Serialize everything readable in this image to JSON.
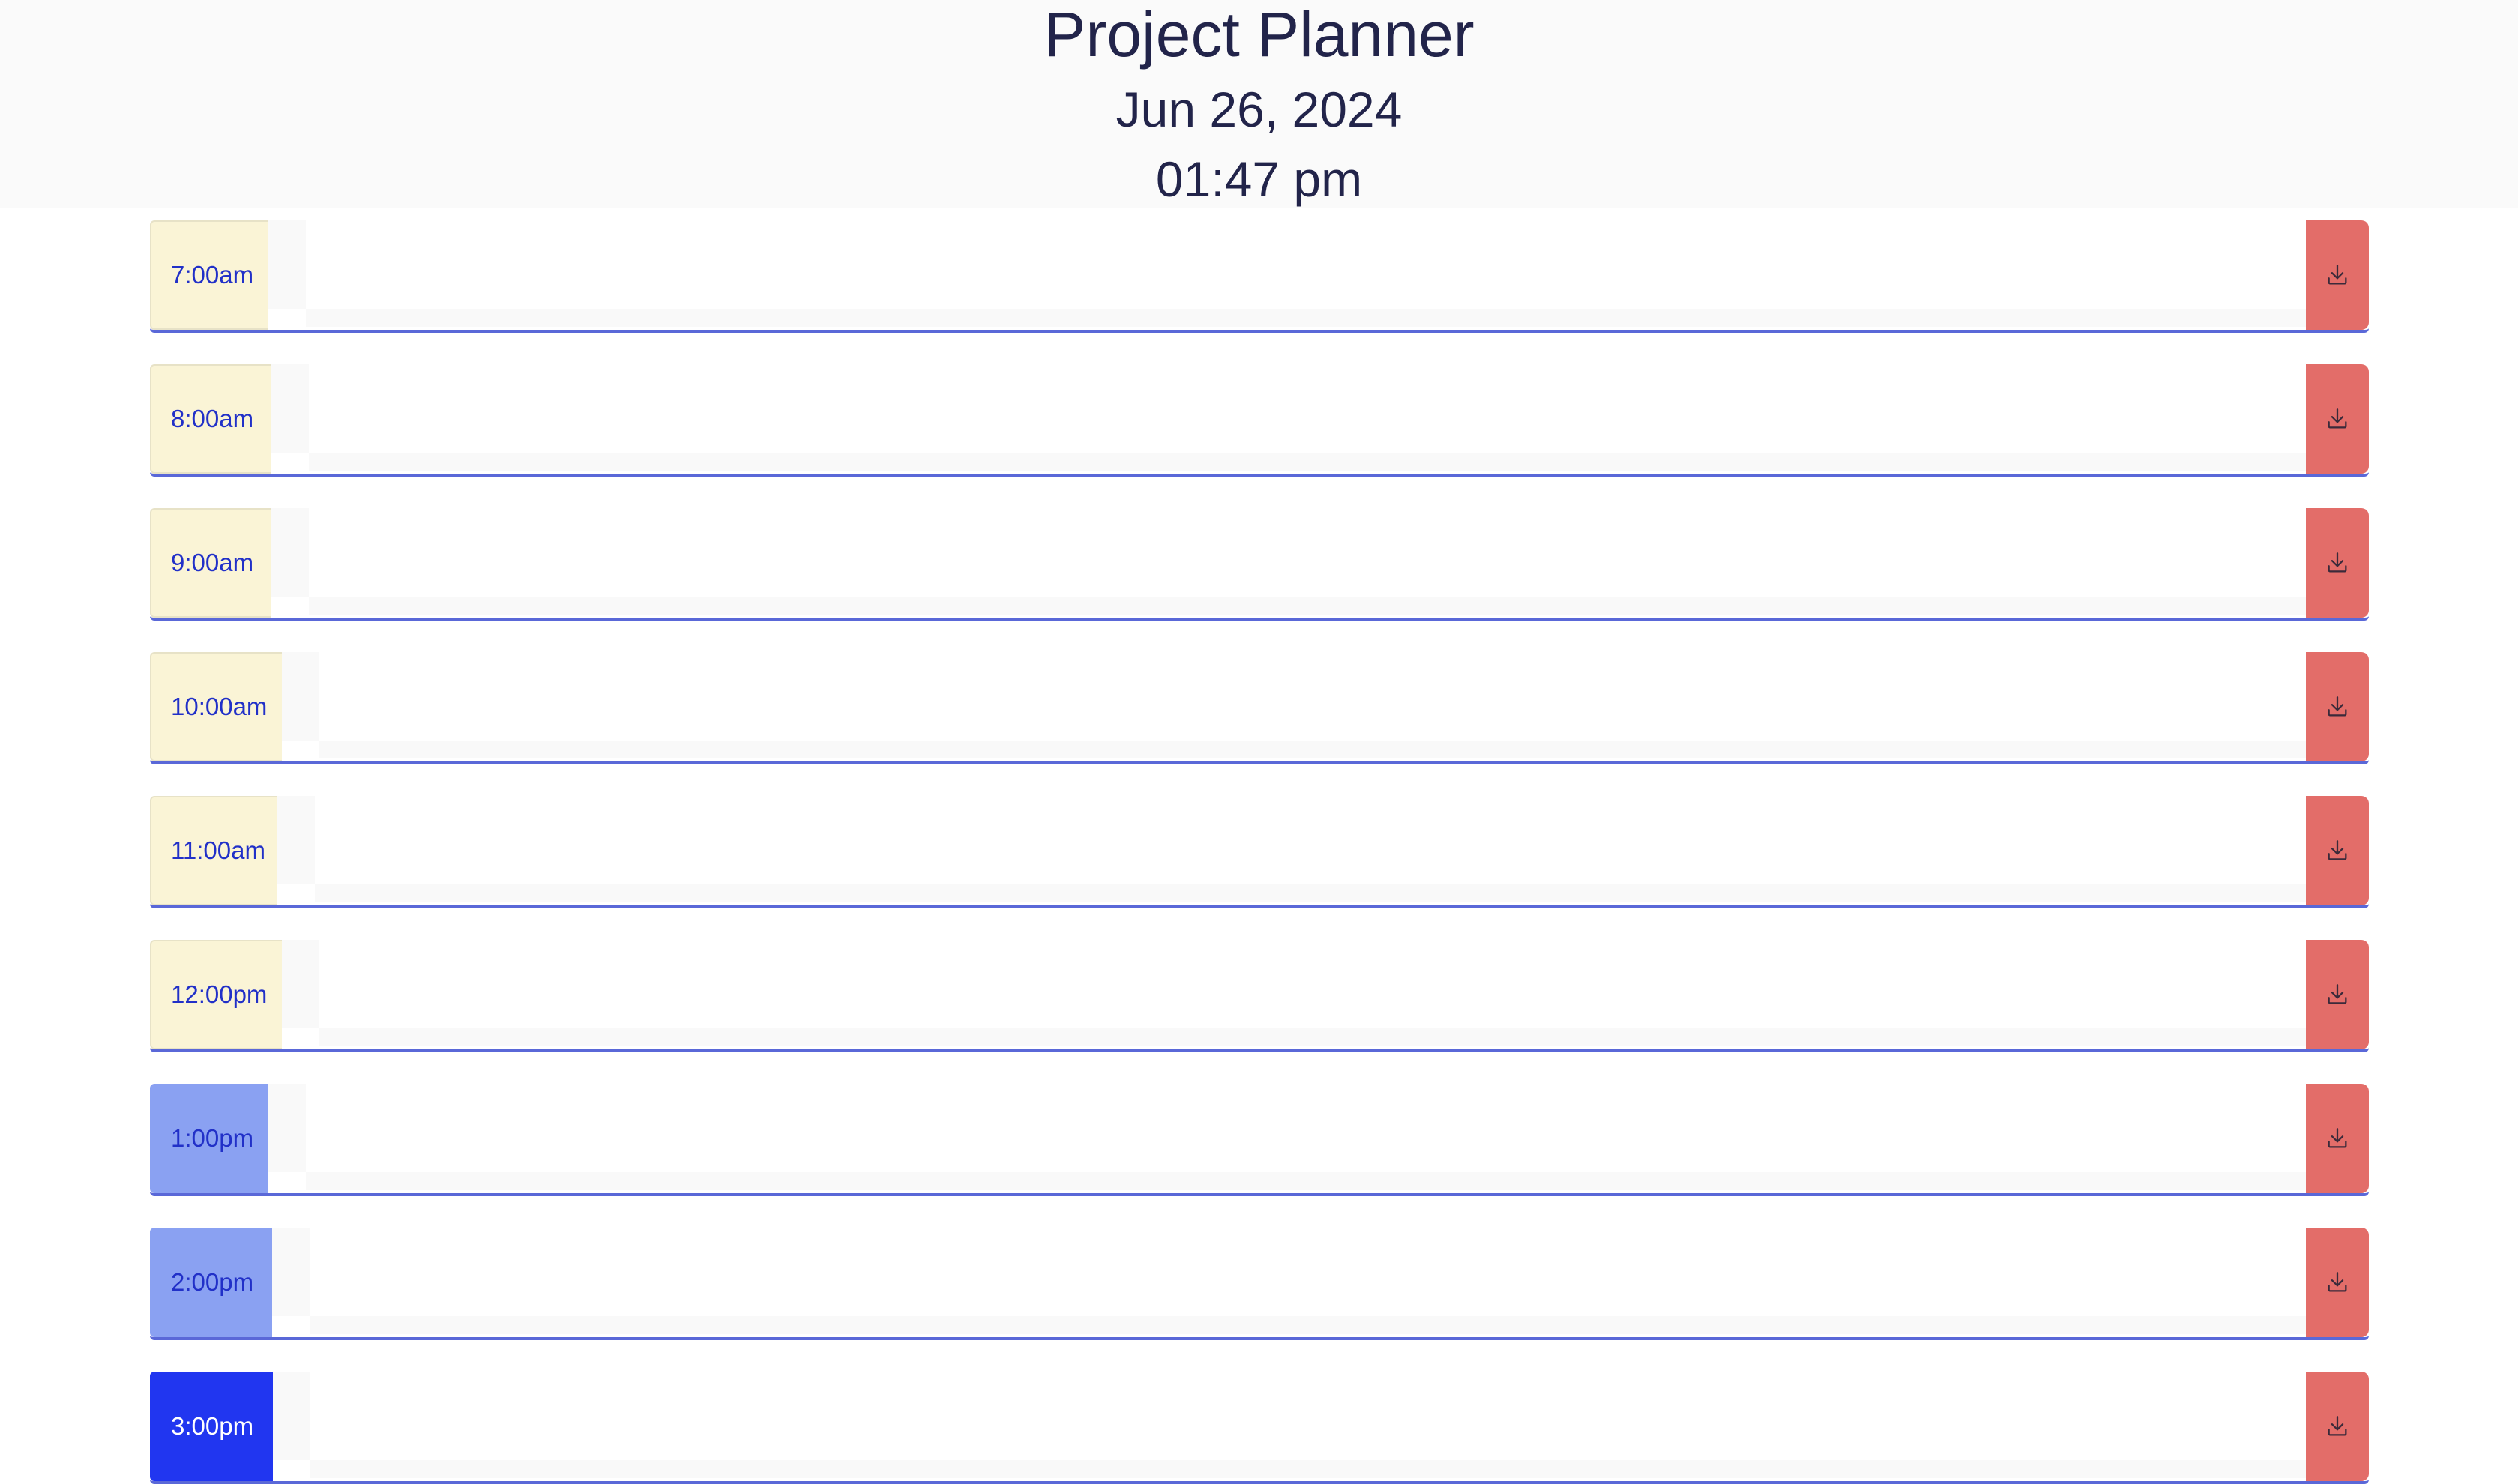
{
  "header": {
    "title": "Project Planner",
    "date": "Jun 26, 2024",
    "time": "01:47 pm"
  },
  "colors": {
    "header_bg": "#fafafa",
    "header_text": "#22244a",
    "past_hour_bg": "#faf4d6",
    "near_hour_bg": "#8aa1f2",
    "current_hour_bg": "#2136f0",
    "save_button_bg": "#e36d69",
    "row_border": "#5a68d8"
  },
  "save_icon": "save-download-icon",
  "time_blocks": [
    {
      "hour": "7:00am",
      "state": "past",
      "note": ""
    },
    {
      "hour": "8:00am",
      "state": "past",
      "note": ""
    },
    {
      "hour": "9:00am",
      "state": "past",
      "note": ""
    },
    {
      "hour": "10:00am",
      "state": "past",
      "note": ""
    },
    {
      "hour": "11:00am",
      "state": "past",
      "note": ""
    },
    {
      "hour": "12:00pm",
      "state": "past",
      "note": ""
    },
    {
      "hour": "1:00pm",
      "state": "near",
      "note": ""
    },
    {
      "hour": "2:00pm",
      "state": "near",
      "note": ""
    },
    {
      "hour": "3:00pm",
      "state": "now",
      "note": ""
    }
  ]
}
